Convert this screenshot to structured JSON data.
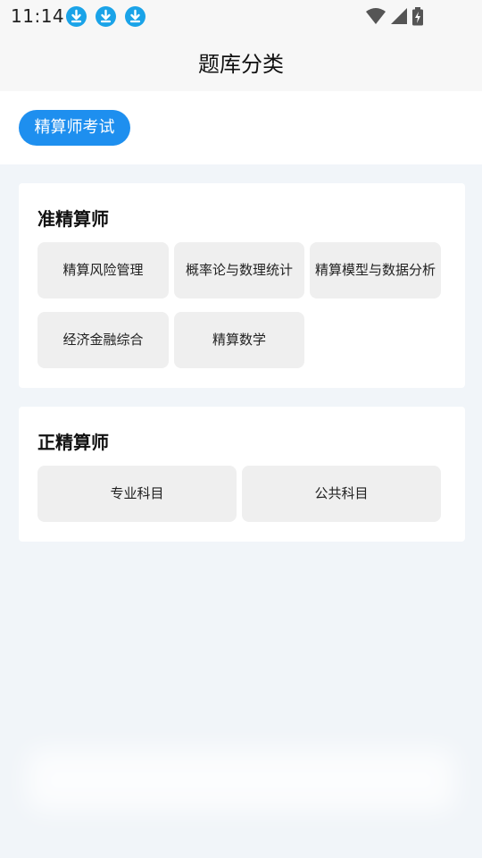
{
  "status_bar": {
    "time": "11:14",
    "icons": [
      "download-icon",
      "download-icon",
      "download-icon",
      "wifi-icon",
      "signal-icon",
      "battery-charging-icon"
    ]
  },
  "header": {
    "title": "题库分类"
  },
  "tabs": [
    {
      "label": "精算师考试",
      "selected": true
    }
  ],
  "sections": [
    {
      "title": "准精算师",
      "items": [
        "精算风险管理",
        "概率论与数理统计",
        "精算模型与数据分析",
        "经济金融综合",
        "精算数学"
      ]
    },
    {
      "title": "正精算师",
      "items": [
        "专业科目",
        "公共科目"
      ]
    }
  ],
  "colors": {
    "accent": "#1e8fef",
    "background": "#f1f5f9",
    "chip": "#efefef",
    "download_badge": "#1aa3e8"
  }
}
